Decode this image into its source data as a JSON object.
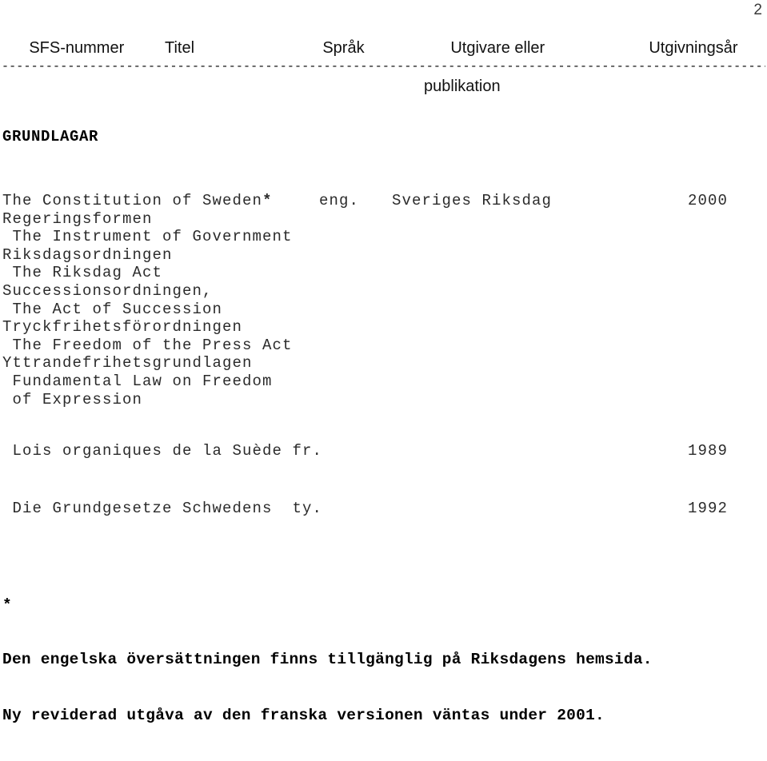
{
  "page": {
    "number": "2"
  },
  "columns": [
    {
      "key": "sfs",
      "label": "SFS-nummer",
      "label_line2": ""
    },
    {
      "key": "titel",
      "label": "Titel",
      "label_line2": ""
    },
    {
      "key": "sprak",
      "label": "Språk",
      "label_line2": ""
    },
    {
      "key": "utg",
      "label": "Utgivare eller",
      "label_line2": "publikation"
    },
    {
      "key": "ar",
      "label": "Utgivningsår",
      "label_line2": ""
    }
  ],
  "rule": "-------------------------------------------------------------------------------------------------------------------------------------------------------------------------",
  "section": {
    "heading": "GRUNDLAGAR"
  },
  "entries": {
    "constitution": {
      "lines": [
        "The Constitution of Sweden",
        "Regeringsformen",
        " The Instrument of Government",
        "Riksdagsordningen",
        " The Riksdag Act",
        "Successionsordningen,",
        " The Act of Succession",
        "Tryckfrihetsförordningen",
        " The Freedom of the Press Act",
        "Yttrandefrihetsgrundlagen",
        " Fundamental Law on Freedom",
        " of Expression"
      ],
      "footnote_marker": "*",
      "language": "eng.",
      "publisher": "Sveriges Riksdag",
      "year": "2000"
    },
    "french": {
      "title": " Lois organiques de la Suède fr.",
      "year": "1989"
    },
    "german": {
      "title": " Die Grundgesetze Schwedens  ty.",
      "year": "1992"
    }
  },
  "footnote": {
    "marker": "*",
    "line1": "Den engelska översättningen finns tillgänglig på Riksdagens hemsida.",
    "line2": "Ny reviderad utgåva av den franska versionen väntas under 2001."
  }
}
